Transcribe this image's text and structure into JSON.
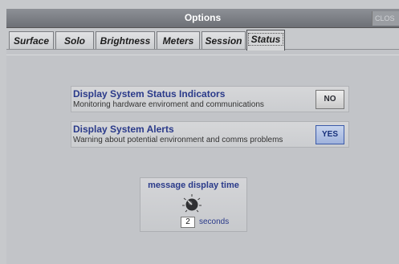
{
  "window": {
    "title": "Options",
    "close_label": "CLOS"
  },
  "tabs": [
    {
      "label": "Surface",
      "active": false
    },
    {
      "label": "Solo",
      "active": false
    },
    {
      "label": "Brightness",
      "active": false
    },
    {
      "label": "Meters",
      "active": false
    },
    {
      "label": "Session",
      "active": false
    },
    {
      "label": "Status",
      "active": true
    }
  ],
  "options": [
    {
      "title": "Display System Status Indicators",
      "description": "Monitoring hardware enviroment and communications",
      "button_label": "NO"
    },
    {
      "title": "Display System Alerts",
      "description": "Warning about potential environment and comms problems",
      "button_label": "YES"
    }
  ],
  "message_display_time": {
    "title": "message display time",
    "value": "2",
    "unit": "seconds"
  },
  "colors": {
    "accent_text": "#2a3a8a",
    "yes_button": "#a9bbe0",
    "title_bar": "#7c7f85"
  }
}
